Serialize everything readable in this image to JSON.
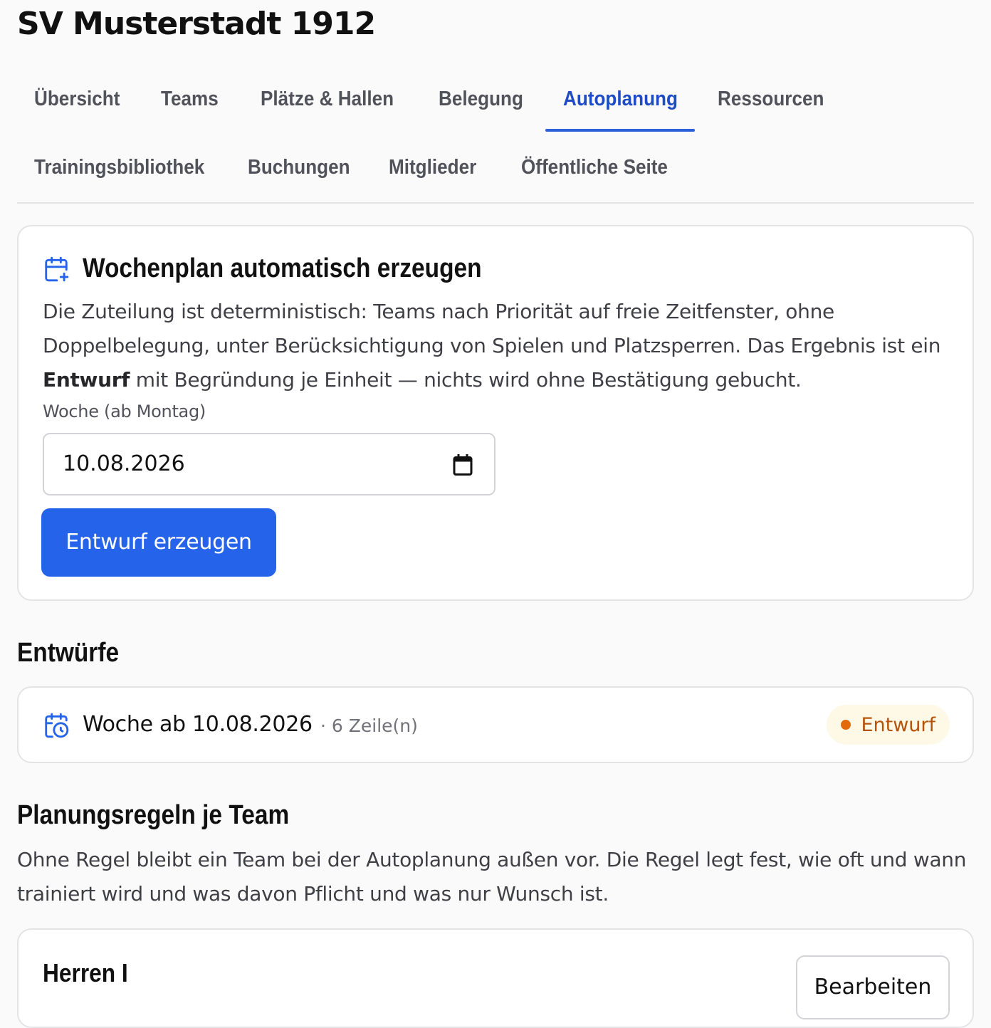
{
  "club": {
    "name": "SV Musterstadt 1912"
  },
  "nav": {
    "tabs": [
      {
        "label": "Übersicht",
        "active": false
      },
      {
        "label": "Teams",
        "active": false
      },
      {
        "label": "Plätze & Hallen",
        "active": false
      },
      {
        "label": "Belegung",
        "active": false
      },
      {
        "label": "Autoplanung",
        "active": true
      },
      {
        "label": "Ressourcen",
        "active": false
      },
      {
        "label": "Trainingsbibliothek",
        "active": false
      },
      {
        "label": "Buchungen",
        "active": false
      },
      {
        "label": "Mitglieder",
        "active": false
      },
      {
        "label": "Öffentliche Seite",
        "active": false
      }
    ]
  },
  "generator": {
    "title": "Wochenplan automatisch erzeugen",
    "icon": "calendar-plus-icon",
    "description_part1": "Die Zuteilung ist deterministisch: Teams nach Priorität auf freie Zeitfenster, ohne Doppelbelegung, unter Berücksichtigung von Spielen und Platzsperren. Das Ergebnis ist ein ",
    "description_bold": "Entwurf",
    "description_part2": " mit Begründung je Einheit — nichts wird ohne Bestätigung gebucht.",
    "week_label": "Woche (ab Montag)",
    "week_value": "10.08.2026",
    "submit_label": "Entwurf erzeugen"
  },
  "drafts": {
    "title": "Entwürfe",
    "items": [
      {
        "icon": "calendar-clock-icon",
        "name": "Woche ab 10.08.2026",
        "meta": "· 6 Zeile(n)",
        "status": "Entwurf"
      }
    ]
  },
  "rules": {
    "title": "Planungsregeln je Team",
    "description": "Ohne Regel bleibt ein Team bei der Autoplanung außen vor. Die Regel legt fest, wie oft und wann trainiert wird und was davon Pflicht und was nur Wunsch ist.",
    "teams": [
      {
        "name": "Herren I",
        "edit_label": "Bearbeiten"
      }
    ]
  },
  "colors": {
    "accent": "#2563eb",
    "active_tab": "#1e4bc6",
    "draft_badge_bg": "#fef9e7",
    "draft_badge_dot": "#e36a0c",
    "draft_badge_text": "#b4530a"
  }
}
